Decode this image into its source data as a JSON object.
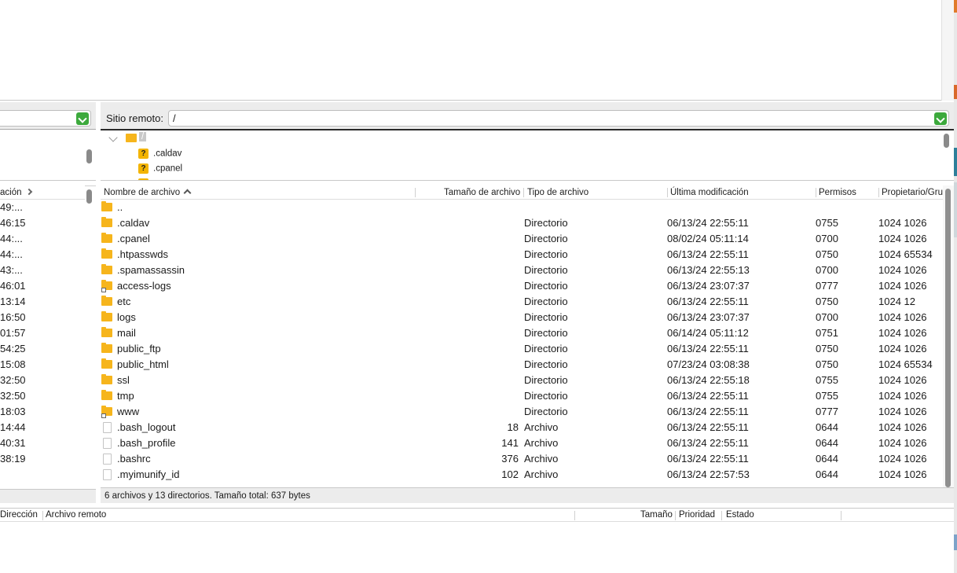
{
  "local": {
    "column_header": "ación",
    "rows": [
      "49:...",
      "46:15",
      "44:...",
      "44:...",
      "43:...",
      "46:01",
      "13:14",
      "16:50",
      "01:57",
      "54:25",
      "15:08",
      "32:50",
      "32:50",
      "18:03",
      "14:44",
      "40:31",
      "38:19"
    ]
  },
  "remote": {
    "label": "Sitio remoto:",
    "path": "/",
    "tree": {
      "root": "/",
      "items": [
        ".caldav",
        ".cpanel"
      ]
    },
    "columns": {
      "name": "Nombre de archivo",
      "size": "Tamaño de archivo",
      "type": "Tipo de archivo",
      "modified": "Última modificación",
      "perms": "Permisos",
      "owner": "Propietario/Gru"
    },
    "files": [
      {
        "name": "..",
        "size": "",
        "type": "",
        "modified": "",
        "perms": "",
        "owner": "",
        "icon": "folder"
      },
      {
        "name": ".caldav",
        "size": "",
        "type": "Directorio",
        "modified": "06/13/24 22:55:11",
        "perms": "0755",
        "owner": "1024 1026",
        "icon": "folder"
      },
      {
        "name": ".cpanel",
        "size": "",
        "type": "Directorio",
        "modified": "08/02/24 05:11:14",
        "perms": "0700",
        "owner": "1024 1026",
        "icon": "folder"
      },
      {
        "name": ".htpasswds",
        "size": "",
        "type": "Directorio",
        "modified": "06/13/24 22:55:11",
        "perms": "0750",
        "owner": "1024 65534",
        "icon": "folder"
      },
      {
        "name": ".spamassassin",
        "size": "",
        "type": "Directorio",
        "modified": "06/13/24 22:55:13",
        "perms": "0700",
        "owner": "1024 1026",
        "icon": "folder"
      },
      {
        "name": "access-logs",
        "size": "",
        "type": "Directorio",
        "modified": "06/13/24 23:07:37",
        "perms": "0777",
        "owner": "1024 1026",
        "icon": "folder-link"
      },
      {
        "name": "etc",
        "size": "",
        "type": "Directorio",
        "modified": "06/13/24 22:55:11",
        "perms": "0750",
        "owner": "1024 12",
        "icon": "folder"
      },
      {
        "name": "logs",
        "size": "",
        "type": "Directorio",
        "modified": "06/13/24 23:07:37",
        "perms": "0700",
        "owner": "1024 1026",
        "icon": "folder"
      },
      {
        "name": "mail",
        "size": "",
        "type": "Directorio",
        "modified": "06/14/24 05:11:12",
        "perms": "0751",
        "owner": "1024 1026",
        "icon": "folder"
      },
      {
        "name": "public_ftp",
        "size": "",
        "type": "Directorio",
        "modified": "06/13/24 22:55:11",
        "perms": "0750",
        "owner": "1024 1026",
        "icon": "folder"
      },
      {
        "name": "public_html",
        "size": "",
        "type": "Directorio",
        "modified": "07/23/24 03:08:38",
        "perms": "0750",
        "owner": "1024 65534",
        "icon": "folder"
      },
      {
        "name": "ssl",
        "size": "",
        "type": "Directorio",
        "modified": "06/13/24 22:55:18",
        "perms": "0755",
        "owner": "1024 1026",
        "icon": "folder"
      },
      {
        "name": "tmp",
        "size": "",
        "type": "Directorio",
        "modified": "06/13/24 22:55:11",
        "perms": "0755",
        "owner": "1024 1026",
        "icon": "folder"
      },
      {
        "name": "www",
        "size": "",
        "type": "Directorio",
        "modified": "06/13/24 22:55:11",
        "perms": "0777",
        "owner": "1024 1026",
        "icon": "folder-link"
      },
      {
        "name": ".bash_logout",
        "size": "18",
        "type": "Archivo",
        "modified": "06/13/24 22:55:11",
        "perms": "0644",
        "owner": "1024 1026",
        "icon": "file"
      },
      {
        "name": ".bash_profile",
        "size": "141",
        "type": "Archivo",
        "modified": "06/13/24 22:55:11",
        "perms": "0644",
        "owner": "1024 1026",
        "icon": "file"
      },
      {
        "name": ".bashrc",
        "size": "376",
        "type": "Archivo",
        "modified": "06/13/24 22:55:11",
        "perms": "0644",
        "owner": "1024 1026",
        "icon": "file"
      },
      {
        "name": ".myimunify_id",
        "size": "102",
        "type": "Archivo",
        "modified": "06/13/24 22:57:53",
        "perms": "0644",
        "owner": "1024 1026",
        "icon": "file"
      }
    ],
    "status": "6 archivos y 13 directorios. Tamaño total: 637 bytes"
  },
  "queue": {
    "columns": {
      "direction": "Dirección",
      "remote_file": "Archivo remoto",
      "size": "Tamaño",
      "priority": "Prioridad",
      "status": "Estado"
    }
  },
  "colors": {
    "folder": "#f6b51c",
    "combo_arrow": "#3ca93c",
    "panel_bg": "#ececec"
  }
}
